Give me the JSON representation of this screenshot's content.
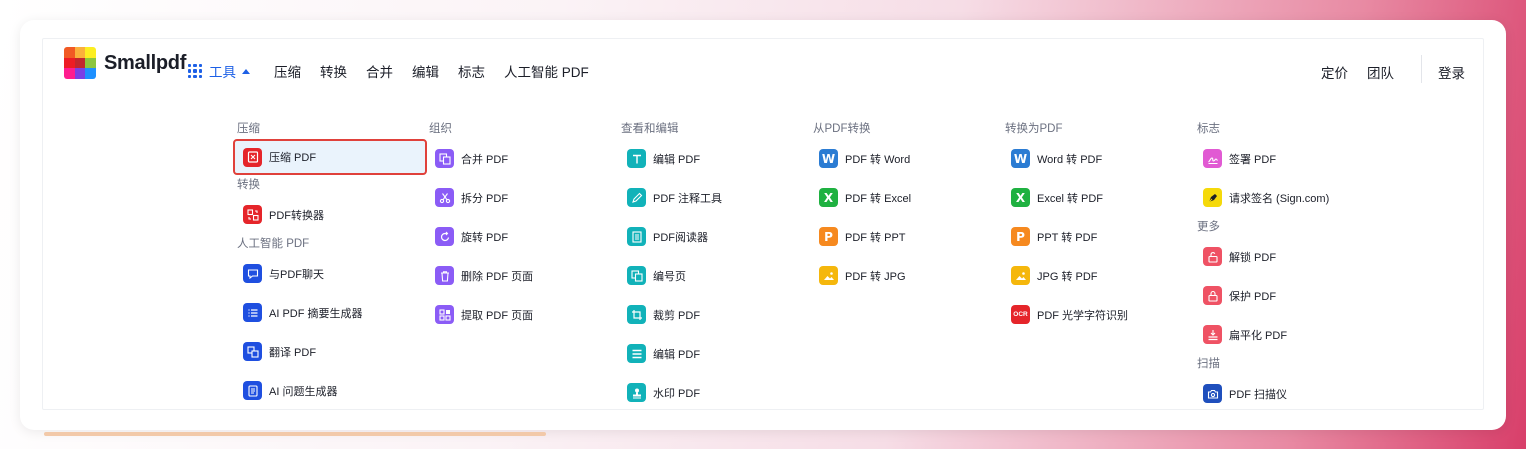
{
  "brand": {
    "name": "Smallpdf"
  },
  "nav": {
    "tools_label": "工具",
    "links": [
      "压缩",
      "转换",
      "合并",
      "编辑",
      "标志",
      "人工智能 PDF"
    ],
    "pricing": "定价",
    "team": "团队",
    "login": "登录"
  },
  "colors": {
    "accent": "#1d60e6",
    "compress": "#e5252a",
    "organize": "#8b5cf6",
    "edit": "#11b2b9",
    "ai": "#1f4fe0",
    "word": "#2b7cd3",
    "excel": "#1fb141",
    "ppt": "#f6891f",
    "jpg": "#f5b70c",
    "sign": "#e15ad3",
    "more": "#ef5264",
    "scan": "#1f4fbd",
    "highlight_border": "#e0413b"
  },
  "menu": {
    "col1": {
      "compress_title": "压缩",
      "compress_items": [
        {
          "label": "压缩 PDF",
          "icon": "compress-icon"
        }
      ],
      "convert_title": "转换",
      "convert_items": [
        {
          "label": "PDF转换器",
          "icon": "converter-icon"
        }
      ],
      "ai_title": "人工智能 PDF",
      "ai_items": [
        {
          "label": "与PDF聊天",
          "icon": "chat-icon"
        },
        {
          "label": "AI PDF 摘要生成器",
          "icon": "list-icon"
        },
        {
          "label": "翻译 PDF",
          "icon": "translate-icon"
        },
        {
          "label": "AI 问题生成器",
          "icon": "question-icon"
        }
      ]
    },
    "col2": {
      "title": "组织",
      "items": [
        {
          "label": "合并 PDF",
          "icon": "merge-icon"
        },
        {
          "label": "拆分 PDF",
          "icon": "scissors-icon"
        },
        {
          "label": "旋转 PDF",
          "icon": "rotate-icon"
        },
        {
          "label": "删除 PDF 页面",
          "icon": "trash-icon"
        },
        {
          "label": "提取 PDF 页面",
          "icon": "extract-icon"
        }
      ]
    },
    "col3": {
      "title": "查看和编辑",
      "items": [
        {
          "label": "编辑 PDF",
          "icon": "text-icon"
        },
        {
          "label": "PDF 注释工具",
          "icon": "pen-icon"
        },
        {
          "label": "PDF阅读器",
          "icon": "reader-icon"
        },
        {
          "label": "编号页",
          "icon": "number-icon"
        },
        {
          "label": "裁剪 PDF",
          "icon": "crop-icon"
        },
        {
          "label": "编辑 PDF",
          "icon": "form-icon"
        },
        {
          "label": "水印 PDF",
          "icon": "stamp-icon"
        }
      ]
    },
    "col4": {
      "title": "从PDF转换",
      "items": [
        {
          "label": "PDF 转 Word",
          "icon": "word-icon",
          "letter": "W"
        },
        {
          "label": "PDF 转 Excel",
          "icon": "excel-icon",
          "letter": "X"
        },
        {
          "label": "PDF 转 PPT",
          "icon": "ppt-icon",
          "letter": "P"
        },
        {
          "label": "PDF 转 JPG",
          "icon": "image-icon"
        }
      ]
    },
    "col5": {
      "title": "转换为PDF",
      "items": [
        {
          "label": "Word 转 PDF",
          "icon": "word-icon",
          "letter": "W"
        },
        {
          "label": "Excel 转 PDF",
          "icon": "excel-icon",
          "letter": "X"
        },
        {
          "label": "PPT 转 PDF",
          "icon": "ppt-icon",
          "letter": "P"
        },
        {
          "label": "JPG 转 PDF",
          "icon": "image-icon"
        },
        {
          "label": "PDF 光学字符识别",
          "icon": "ocr-icon",
          "badge": "OCR"
        }
      ]
    },
    "col6": {
      "sign_title": "标志",
      "sign_items": [
        {
          "label": "签署 PDF",
          "icon": "signature-icon"
        },
        {
          "label": "请求签名 (Sign.com)",
          "icon": "pen-nib-icon"
        }
      ],
      "more_title": "更多",
      "more_items": [
        {
          "label": "解锁 PDF",
          "icon": "unlock-icon"
        },
        {
          "label": "保护 PDF",
          "icon": "lock-icon"
        },
        {
          "label": "扁平化 PDF",
          "icon": "flatten-icon"
        }
      ],
      "scan_title": "扫描",
      "scan_items": [
        {
          "label": "PDF 扫描仪",
          "icon": "camera-icon"
        }
      ]
    }
  }
}
